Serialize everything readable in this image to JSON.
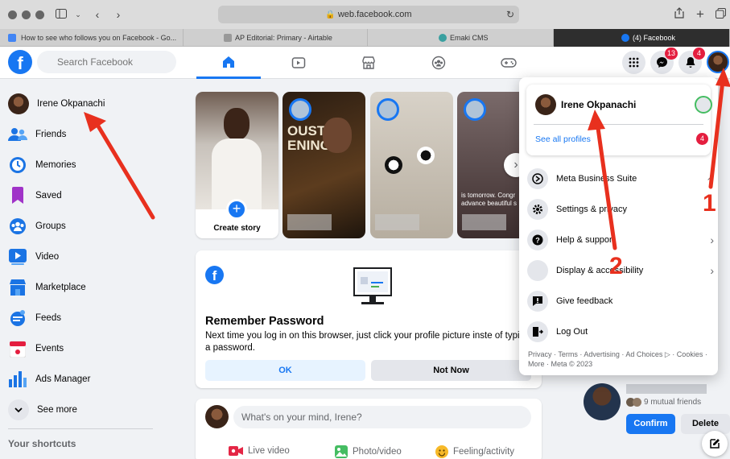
{
  "browser": {
    "url": "web.facebook.com",
    "tabs": [
      {
        "label": "How to see who follows you on Facebook - Go..."
      },
      {
        "label": "AP Editorial: Primary - Airtable"
      },
      {
        "label": "Emaki CMS"
      },
      {
        "label": "(4) Facebook"
      }
    ]
  },
  "header": {
    "logo": "f",
    "search_placeholder": "Search Facebook",
    "messenger_badge": "13",
    "notifications_badge": "4"
  },
  "sidebar": {
    "user_name": "Irene Okpanachi",
    "items": [
      {
        "label": "Friends"
      },
      {
        "label": "Memories"
      },
      {
        "label": "Saved"
      },
      {
        "label": "Groups"
      },
      {
        "label": "Video"
      },
      {
        "label": "Marketplace"
      },
      {
        "label": "Feeds"
      },
      {
        "label": "Events"
      },
      {
        "label": "Ads Manager"
      },
      {
        "label": "See more"
      }
    ],
    "shortcuts_heading": "Your shortcuts"
  },
  "stories": {
    "create_label": "Create story",
    "texts": {
      "story2_headline": "OUSTIC ENING",
      "story4_caption": "is tomorrow. Congr advance beautiful s"
    }
  },
  "remember_password": {
    "title": "Remember Password",
    "body": "Next time you log in on this browser, just click your profile picture inste of typing a password.",
    "ok_label": "OK",
    "not_now_label": "Not Now"
  },
  "composer": {
    "placeholder": "What's on your mind, Irene?",
    "actions": [
      {
        "label": "Live video"
      },
      {
        "label": "Photo/video"
      },
      {
        "label": "Feeling/activity"
      }
    ]
  },
  "dropdown": {
    "profile_name": "Irene Okpanachi",
    "see_all_profiles": "See all profiles",
    "profiles_badge": "4",
    "items": [
      {
        "label": "Meta Business Suite"
      },
      {
        "label": "Settings & privacy"
      },
      {
        "label": "Help & support"
      },
      {
        "label": "Display & accessibility"
      },
      {
        "label": "Give feedback"
      },
      {
        "label": "Log Out"
      }
    ],
    "footer": "Privacy · Terms · Advertising · Ad Choices ▷ · Cookies · More · Meta © 2023"
  },
  "friend_request": {
    "mutual": "9 mutual friends",
    "confirm_label": "Confirm",
    "delete_label": "Delete"
  },
  "annotations": {
    "step1": "1",
    "step2": "2"
  },
  "colors": {
    "brand": "#1877f2",
    "arrow": "#e8301e",
    "badge": "#e41e3f"
  }
}
